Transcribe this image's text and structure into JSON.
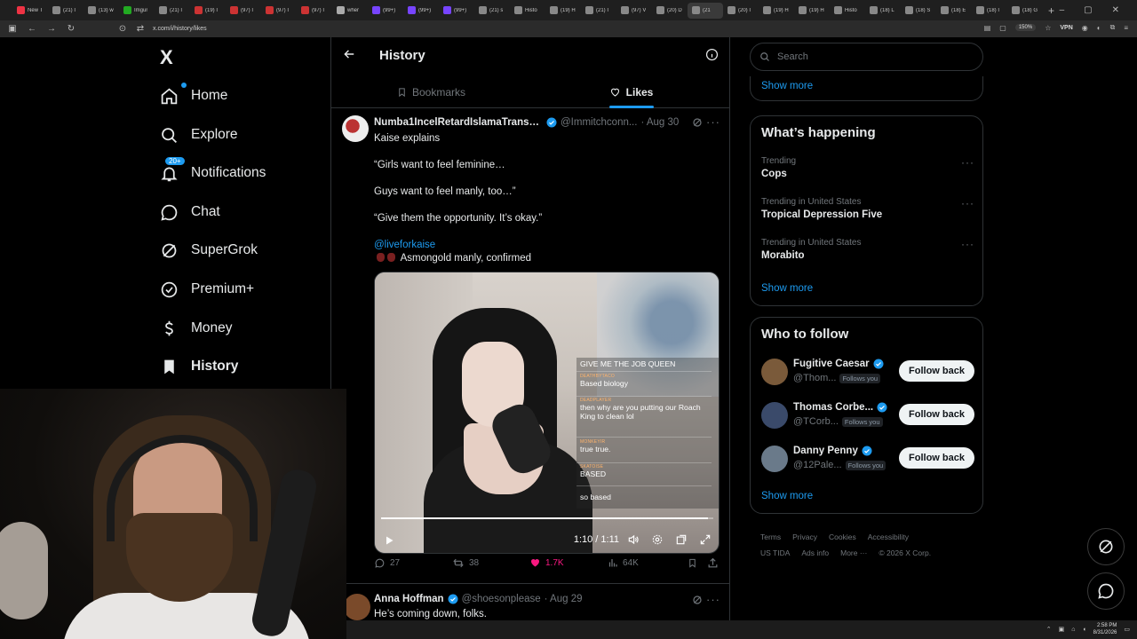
{
  "browser": {
    "tabs": [
      {
        "label": "New T"
      },
      {
        "label": "(21) I"
      },
      {
        "label": "(13) w"
      },
      {
        "label": "Imgur"
      },
      {
        "label": "(21) I"
      },
      {
        "label": "(19) I"
      },
      {
        "label": "(97) I"
      },
      {
        "label": "(97) I"
      },
      {
        "label": "(97) I"
      },
      {
        "label": "wher"
      },
      {
        "label": "(99+)"
      },
      {
        "label": "(99+)"
      },
      {
        "label": "(99+)"
      },
      {
        "label": "(21) s"
      },
      {
        "label": "Histo"
      },
      {
        "label": "(19) H"
      },
      {
        "label": "(21) I"
      },
      {
        "label": "(97) V"
      },
      {
        "label": "(20) D"
      },
      {
        "label": "(21"
      },
      {
        "label": "(20) I"
      },
      {
        "label": "(19) H"
      },
      {
        "label": "(19) H"
      },
      {
        "label": "Histo"
      },
      {
        "label": "(18) L"
      },
      {
        "label": "(18) S"
      },
      {
        "label": "(18) E"
      },
      {
        "label": "(18) I"
      },
      {
        "label": "(18) G"
      }
    ],
    "url": "x.com/i/history/likes",
    "zoom": "150%",
    "vpn_label": "VPN"
  },
  "nav": {
    "logo": "X",
    "items": [
      {
        "label": "Home",
        "icon": "home-icon"
      },
      {
        "label": "Explore",
        "icon": "search-icon"
      },
      {
        "label": "Notifications",
        "icon": "bell-icon",
        "badge": "20+"
      },
      {
        "label": "Chat",
        "icon": "chat-icon"
      },
      {
        "label": "SuperGrok",
        "icon": "grok-icon"
      },
      {
        "label": "Premium+",
        "icon": "premium-icon"
      },
      {
        "label": "Money",
        "icon": "dollar-icon"
      },
      {
        "label": "History",
        "icon": "bookmark-icon"
      }
    ]
  },
  "header": {
    "title": "History",
    "tabs": [
      {
        "label": "Bookmarks"
      },
      {
        "label": "Likes"
      }
    ]
  },
  "post": {
    "name": "Numba1IncelRetardIslamaTransp...",
    "handle": "@Immitchconn...",
    "date": "· Aug 30",
    "lines": [
      "Kaise explains",
      "“Girls want to feel feminine…",
      "Guys want to feel manly, too…”",
      "“Give them the opportunity. It’s okay.”",
      "@liveforkaise",
      "Asmongold manly, confirmed"
    ],
    "video": {
      "chat": [
        {
          "text": "GIVE ME THE JOB QUEEN"
        },
        {
          "user": "DEATHBYTACO",
          "text": "Based biology"
        },
        {
          "user": "DEADPLAYER",
          "text": "then why are you putting our Roach King to clean lol"
        },
        {
          "user": "MONKEYIR",
          "text": "true true."
        },
        {
          "user": "SKATOISE",
          "text": "BASED"
        },
        {
          "user": "",
          "text": "so based"
        }
      ],
      "time": "1:10 / 1:11",
      "progress": 0.985
    },
    "stats": {
      "replies": "27",
      "reposts": "38",
      "likes": "1.7K",
      "views": "64K"
    }
  },
  "post2": {
    "name": "Anna Hoffman",
    "handle": "@shoesonplease",
    "date": "· Aug 29",
    "text": "He’s coming down, folks."
  },
  "right": {
    "search_placeholder": "Search",
    "show_more": "Show more",
    "happening_title": "What’s happening",
    "trends": [
      {
        "context": "Trending",
        "name": "Cops"
      },
      {
        "context": "Trending in United States",
        "name": "Tropical Depression Five"
      },
      {
        "context": "Trending in United States",
        "name": "Morabito"
      }
    ],
    "follow_title": "Who to follow",
    "follow": [
      {
        "name": "Fugitive Caesar",
        "handle": "@Thom...",
        "follows_you": "Follows you",
        "button": "Follow back",
        "color": "#7a5a3a"
      },
      {
        "name": "Thomas Corbe...",
        "handle": "@TCorb...",
        "follows_you": "Follows you",
        "button": "Follow back",
        "color": "#3a4a6a"
      },
      {
        "name": "Danny Penny",
        "handle": "@12Pale...",
        "follows_you": "Follows you",
        "button": "Follow back",
        "color": "#6a7a8a"
      }
    ],
    "footer": [
      "Terms",
      "Privacy",
      "Cookies",
      "Accessibility",
      "US TIDA",
      "Ads info",
      "More ···",
      "© 2026 X Corp."
    ]
  },
  "taskbar": {
    "time": "2:58 PM",
    "date": "8/31/2026"
  },
  "colors": {
    "accent": "#1d9bf0",
    "like": "#f91880",
    "text": "#e7e9ea",
    "muted": "#71767b",
    "border": "#2f3336"
  }
}
